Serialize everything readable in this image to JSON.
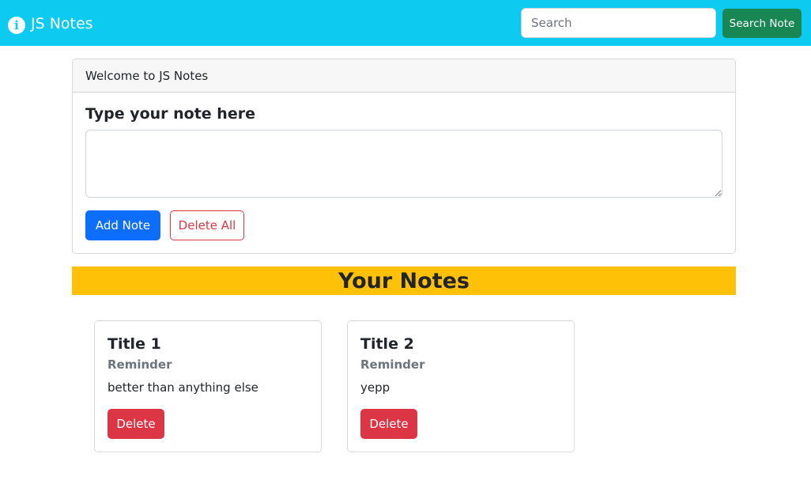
{
  "navbar": {
    "brand": "JS Notes",
    "brand_icon": "info-icon",
    "search_placeholder": "Search",
    "search_value": "",
    "search_button": "Search Note",
    "bg_color": "#0dcaf0"
  },
  "composer": {
    "header": "Welcome to JS Notes",
    "title": "Type your note here",
    "textarea_value": "",
    "add_button": "Add Note",
    "delete_all_button": "Delete All"
  },
  "notes_heading": "Your Notes",
  "notes": [
    {
      "title": "Title 1",
      "subtitle": "Reminder",
      "text": "better than anything else",
      "delete_label": "Delete"
    },
    {
      "title": "Title 2",
      "subtitle": "Reminder",
      "text": "yepp",
      "delete_label": "Delete"
    }
  ]
}
